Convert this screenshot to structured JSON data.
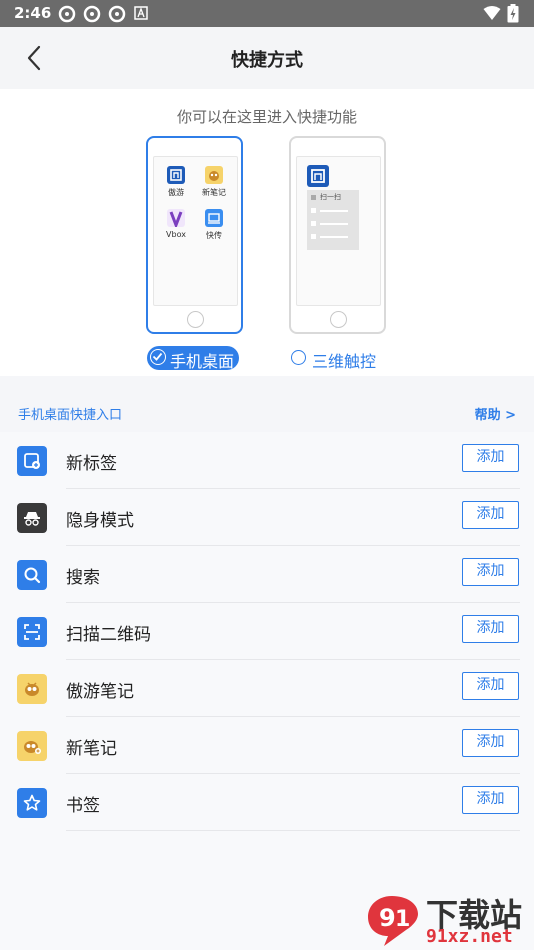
{
  "status": {
    "time": "2:46"
  },
  "header": {
    "title": "快捷方式"
  },
  "hero": {
    "subtitle": "你可以在这里进入快捷功能",
    "desktop_apps": [
      {
        "name": "傲游",
        "color": "#1e5bb8"
      },
      {
        "name": "新笔记",
        "color": "#f6d36a"
      },
      {
        "name": "Vbox",
        "color": "#7b3fbf"
      },
      {
        "name": "快传",
        "color": "#3a8ef0"
      }
    ],
    "touch_mock": {
      "label": "扫一扫"
    },
    "options": [
      {
        "label": "手机桌面",
        "selected": true
      },
      {
        "label": "三维触控",
        "selected": false
      }
    ]
  },
  "section": {
    "title": "手机桌面快捷入口",
    "help": "帮助 >"
  },
  "shortcuts": [
    {
      "name": "新标签",
      "icon": "new-tab-icon",
      "color": "#2f7ee8",
      "action": "添加"
    },
    {
      "name": "隐身模式",
      "icon": "incognito-icon",
      "color": "#3a3a3a",
      "action": "添加"
    },
    {
      "name": "搜索",
      "icon": "search-icon",
      "color": "#2f7ee8",
      "action": "添加"
    },
    {
      "name": "扫描二维码",
      "icon": "qr-scan-icon",
      "color": "#2f7ee8",
      "action": "添加"
    },
    {
      "name": "傲游笔记",
      "icon": "maxthon-note-icon",
      "color": "#f6d36a",
      "action": "添加"
    },
    {
      "name": "新笔记",
      "icon": "new-note-icon",
      "color": "#f6d36a",
      "action": "添加"
    },
    {
      "name": "书签",
      "icon": "bookmark-icon",
      "color": "#2f7ee8",
      "action": "添加"
    }
  ],
  "watermark": {
    "line1": "下载站",
    "line2": "91xz.net"
  }
}
